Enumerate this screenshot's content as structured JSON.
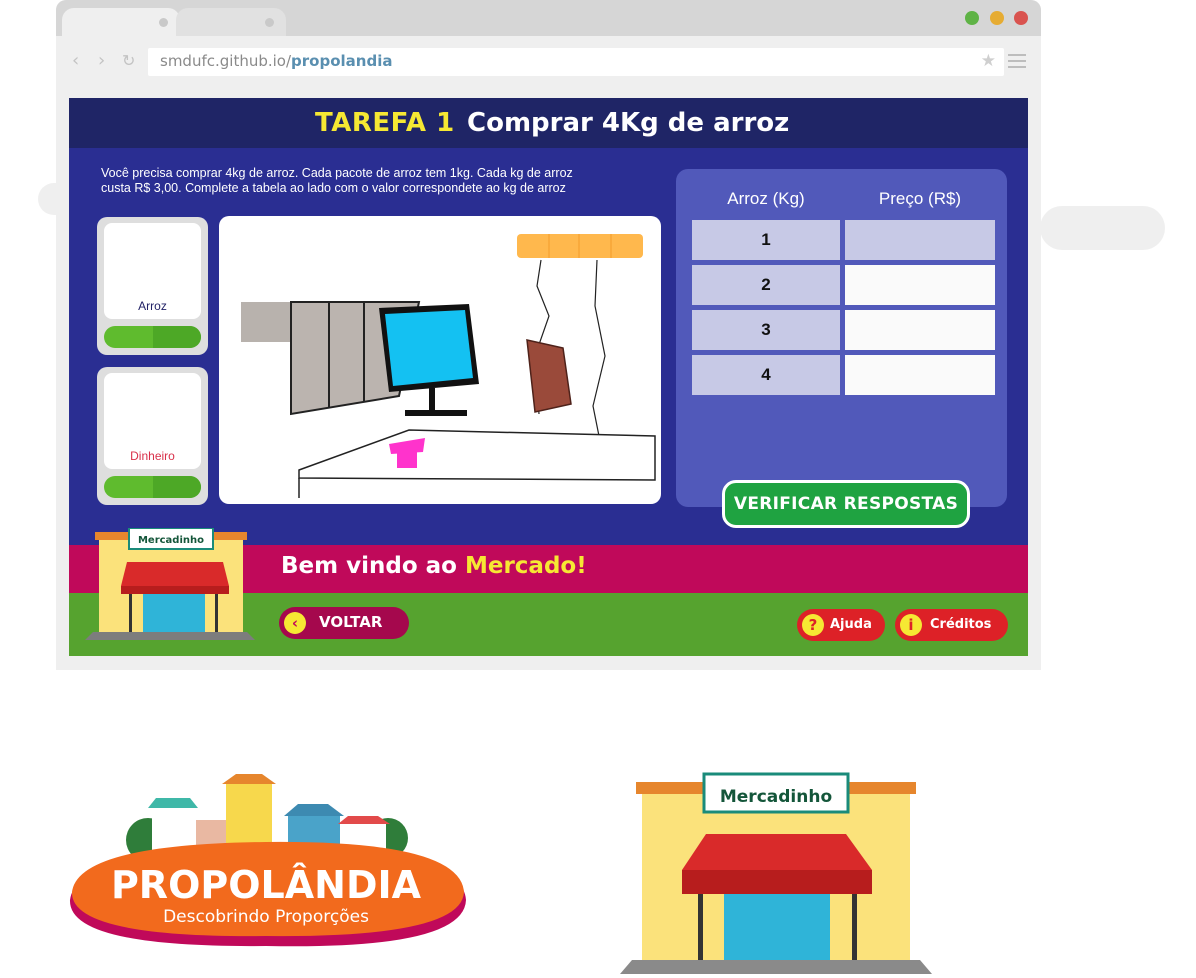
{
  "browser": {
    "url_host": "smdufc.github.io/",
    "url_path": "propolandia",
    "traffic_light_colors": [
      "#5fb346",
      "#e6ac33",
      "#d9534f"
    ]
  },
  "task": {
    "label": "TAREFA 1",
    "title": "Comprar 4Kg de arroz",
    "instructions_line1": "Você precisa comprar 4kg de arroz. Cada pacote de arroz tem 1kg. Cada kg de arroz",
    "instructions_line2": "custa R$ 3,00. Complete a tabela ao lado com o valor correspondete ao kg de arroz"
  },
  "items": [
    {
      "label": "Arroz",
      "color": "#222266"
    },
    {
      "label": "Dinheiro",
      "color": "#d9304a"
    }
  ],
  "table": {
    "headers": [
      "Arroz (Kg)",
      "Preço (R$)"
    ],
    "rows": [
      {
        "kg": "1",
        "price": ""
      },
      {
        "kg": "2",
        "price": ""
      },
      {
        "kg": "3",
        "price": ""
      },
      {
        "kg": "4",
        "price": ""
      }
    ]
  },
  "buttons": {
    "verify": "VERIFICAR RESPOSTAS",
    "back": "VOLTAR",
    "help": "Ajuda",
    "credits": "Créditos"
  },
  "banner": {
    "welcome_prefix": "Bem vindo ao ",
    "welcome_highlight": "Mercado!"
  },
  "store_sign": "Mercadinho",
  "logo": {
    "title": "PROPOLÂNDIA",
    "subtitle": "Descobrindo Proporções"
  },
  "colors": {
    "game_bg": "#2a2e92",
    "topbar": "#1f2566",
    "banner": "#c0095a",
    "grass": "#56a32f",
    "accent_yellow": "#f6e833",
    "verify_green": "#1fa341"
  }
}
